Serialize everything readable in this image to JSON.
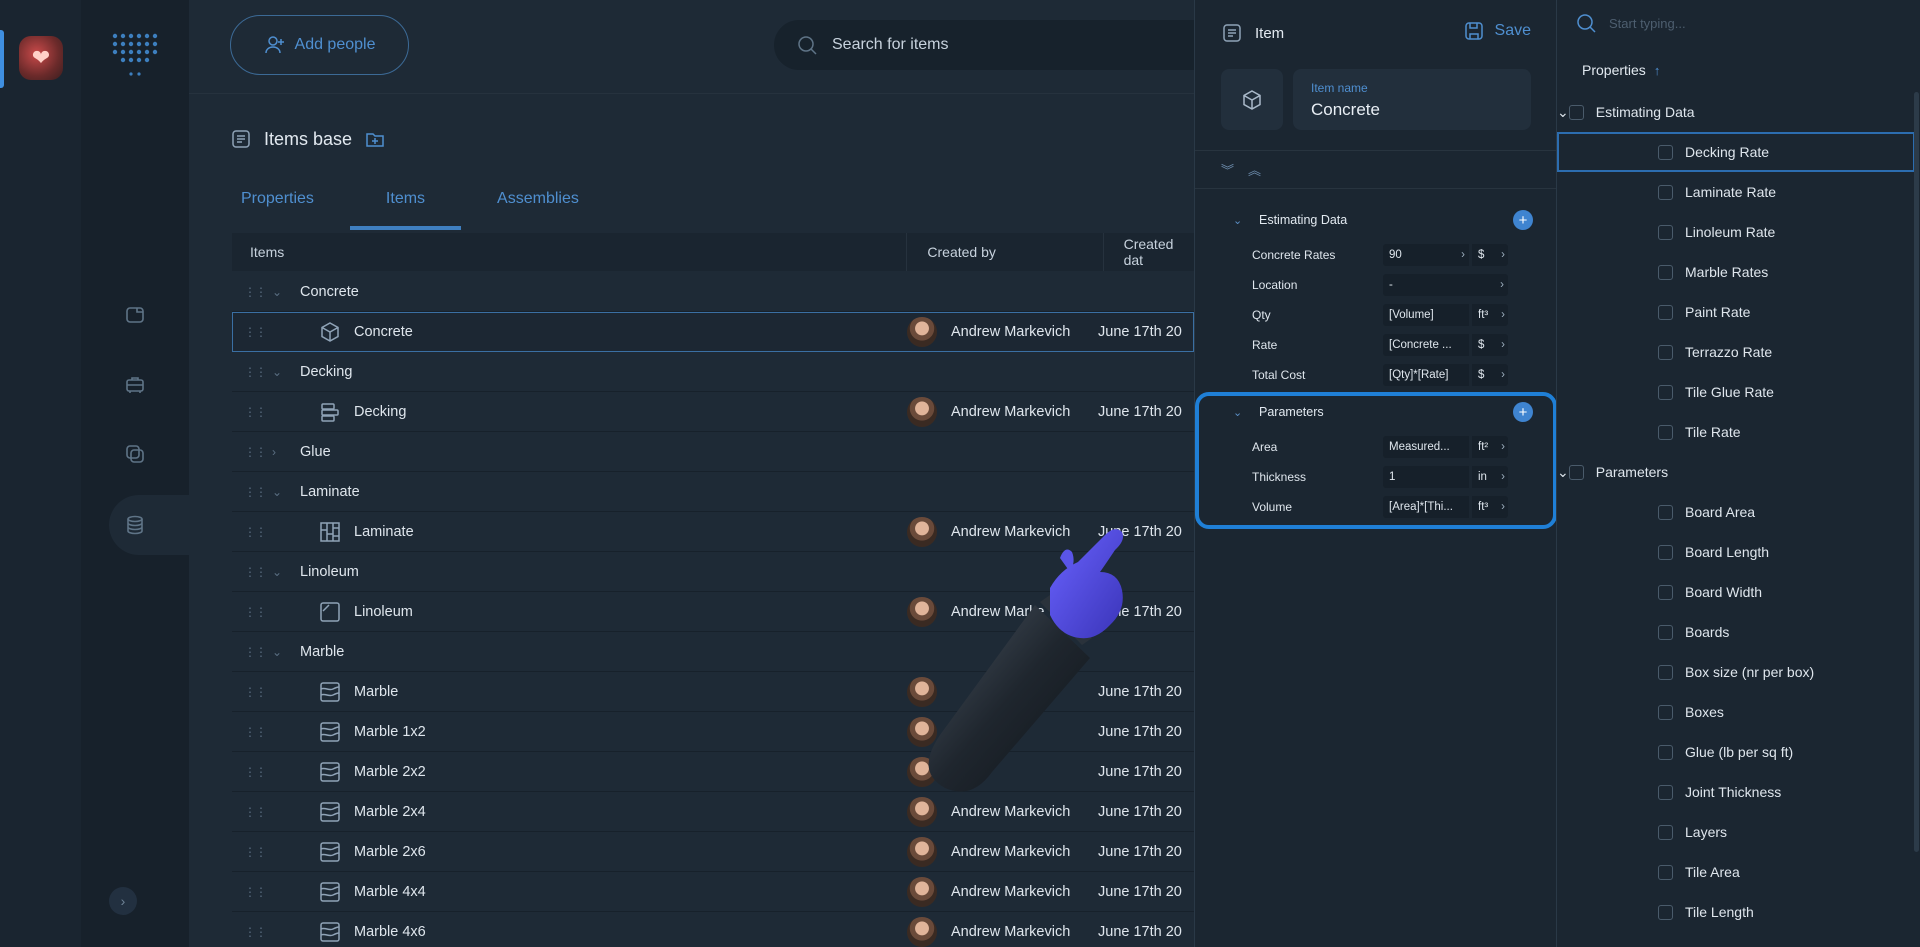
{
  "toolbar": {
    "add_people": "Add people",
    "search_placeholder": "Search for items"
  },
  "page": {
    "title": "Items base"
  },
  "tabs": [
    {
      "label": "Properties"
    },
    {
      "label": "Items",
      "active": true
    },
    {
      "label": "Assemblies"
    }
  ],
  "table": {
    "headers": {
      "items": "Items",
      "created_by": "Created by",
      "created_date": "Created dat"
    },
    "rows": [
      {
        "type": "group",
        "label": "Concrete",
        "expanded": true
      },
      {
        "type": "item",
        "label": "Concrete",
        "icon": "cube-icon",
        "creator": "Andrew Markevich",
        "date": "June 17th 20",
        "selected": true
      },
      {
        "type": "group",
        "label": "Decking",
        "expanded": true
      },
      {
        "type": "item",
        "label": "Decking",
        "icon": "decking-icon",
        "creator": "Andrew Markevich",
        "date": "June 17th 20"
      },
      {
        "type": "group",
        "label": "Glue",
        "expanded": false
      },
      {
        "type": "group",
        "label": "Laminate",
        "expanded": true
      },
      {
        "type": "item",
        "label": "Laminate",
        "icon": "laminate-icon",
        "creator": "Andrew Markevich",
        "date": "June 17th 20"
      },
      {
        "type": "group",
        "label": "Linoleum",
        "expanded": true
      },
      {
        "type": "item",
        "label": "Linoleum",
        "icon": "linoleum-icon",
        "creator": "Andrew Marke",
        "date": "June 17th 20"
      },
      {
        "type": "group",
        "label": "Marble",
        "expanded": true
      },
      {
        "type": "item",
        "label": "Marble",
        "icon": "marble-icon",
        "creator": "",
        "date": "June 17th 20"
      },
      {
        "type": "item",
        "label": "Marble 1x2",
        "icon": "marble-icon",
        "creator": "",
        "date": "June 17th 20"
      },
      {
        "type": "item",
        "label": "Marble 2x2",
        "icon": "marble-icon",
        "creator": "",
        "date": "June 17th 20"
      },
      {
        "type": "item",
        "label": "Marble 2x4",
        "icon": "marble-icon",
        "creator": "Andrew Markevich",
        "date": "June 17th 20"
      },
      {
        "type": "item",
        "label": "Marble 2x6",
        "icon": "marble-icon",
        "creator": "Andrew Markevich",
        "date": "June 17th 20"
      },
      {
        "type": "item",
        "label": "Marble 4x4",
        "icon": "marble-icon",
        "creator": "Andrew Markevich",
        "date": "June 17th 20"
      },
      {
        "type": "item",
        "label": "Marble 4x6",
        "icon": "marble-icon",
        "creator": "Andrew Markevich",
        "date": "June 17th 20"
      }
    ]
  },
  "item_panel": {
    "title": "Item",
    "save_label": "Save",
    "name_label": "Item name",
    "name_value": "Concrete",
    "sections": [
      {
        "title": "Estimating Data",
        "props": [
          {
            "name": "Concrete Rates",
            "value": "90",
            "unit": "$"
          },
          {
            "name": "Location",
            "value": "-",
            "unit": ""
          },
          {
            "name": "Qty",
            "value": "[Volume]",
            "unit": "ft³"
          },
          {
            "name": "Rate",
            "value": "[Concrete ...",
            "unit": "$"
          },
          {
            "name": "Total Cost",
            "value": "[Qty]*[Rate]",
            "unit": "$"
          }
        ]
      },
      {
        "title": "Parameters",
        "props": [
          {
            "name": "Area",
            "value": "Measured...",
            "unit": "ft²"
          },
          {
            "name": "Thickness",
            "value": "1",
            "unit": "in"
          },
          {
            "name": "Volume",
            "value": "[Area]*[Thi...",
            "unit": "ft³"
          }
        ]
      }
    ]
  },
  "properties_panel": {
    "search_placeholder": "Start typing...",
    "title": "Properties",
    "list": [
      {
        "type": "group",
        "label": "Estimating Data"
      },
      {
        "type": "leaf",
        "label": "Decking Rate",
        "focused": true
      },
      {
        "type": "leaf",
        "label": "Laminate Rate"
      },
      {
        "type": "leaf",
        "label": "Linoleum Rate"
      },
      {
        "type": "leaf",
        "label": "Marble Rates"
      },
      {
        "type": "leaf",
        "label": "Paint Rate"
      },
      {
        "type": "leaf",
        "label": "Terrazzo Rate"
      },
      {
        "type": "leaf",
        "label": "Tile Glue Rate"
      },
      {
        "type": "leaf",
        "label": "Tile Rate"
      },
      {
        "type": "group",
        "label": "Parameters"
      },
      {
        "type": "leaf",
        "label": "Board Area"
      },
      {
        "type": "leaf",
        "label": "Board Length"
      },
      {
        "type": "leaf",
        "label": "Board Width"
      },
      {
        "type": "leaf",
        "label": "Boards"
      },
      {
        "type": "leaf",
        "label": "Box size (nr per box)"
      },
      {
        "type": "leaf",
        "label": "Boxes"
      },
      {
        "type": "leaf",
        "label": "Glue (lb per sq ft)"
      },
      {
        "type": "leaf",
        "label": "Joint Thickness"
      },
      {
        "type": "leaf",
        "label": "Layers"
      },
      {
        "type": "leaf",
        "label": "Tile Area"
      },
      {
        "type": "leaf",
        "label": "Tile Length"
      }
    ]
  },
  "colors": {
    "accent": "#3f84d0",
    "highlight": "#1f7fd6",
    "background": "#1e2a36"
  }
}
